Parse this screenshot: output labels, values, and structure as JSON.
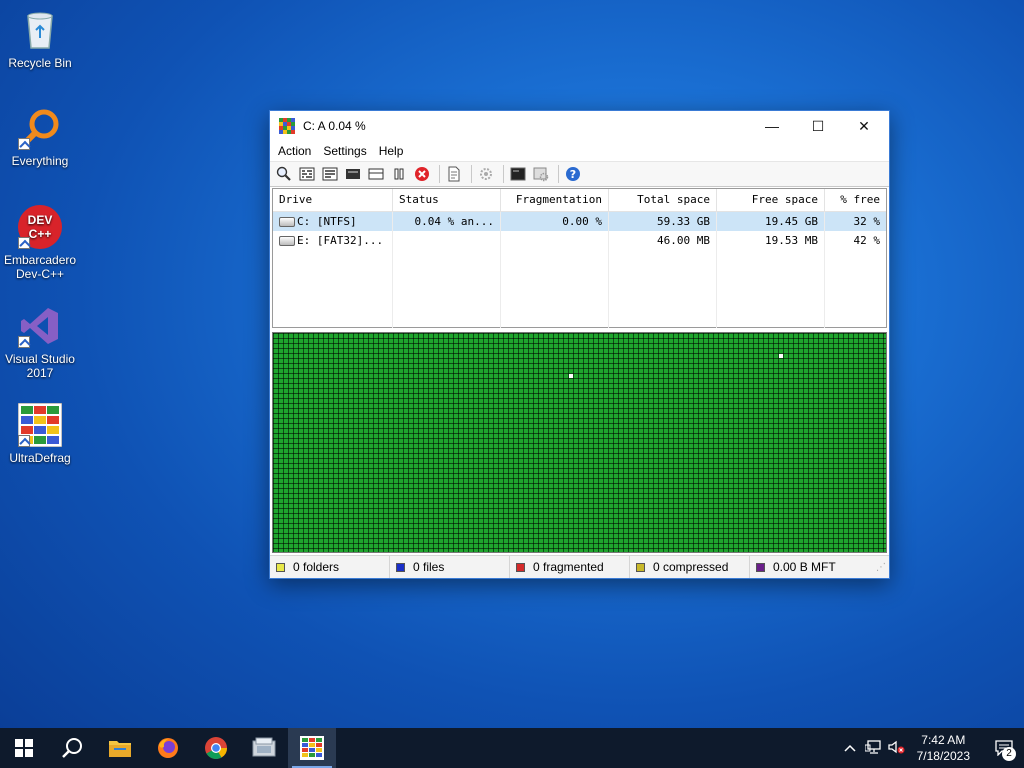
{
  "desktop": {
    "icons": [
      {
        "label": "Recycle Bin"
      },
      {
        "label": "Everything"
      },
      {
        "label": "Embarcadero Dev-C++",
        "logo_line1": "DEV",
        "logo_line2": "C++"
      },
      {
        "label": "Visual Studio 2017"
      },
      {
        "label": "UltraDefrag"
      }
    ]
  },
  "window": {
    "title": "C:  A   0.04 %",
    "controls": {
      "minimize": "—",
      "maximize": "☐",
      "close": "✕"
    },
    "menu": [
      "Action",
      "Settings",
      "Help"
    ],
    "toolbar_icons": [
      "analyze-icon",
      "defragment-icon",
      "quick-optimize-icon",
      "full-optimize-icon",
      "mft-optimize-icon",
      "pause-icon",
      "stop-icon",
      "report-icon",
      "preferences-icon",
      "boot-time-script-icon",
      "boot-time-enable-icon",
      "help-icon"
    ],
    "columns": [
      "Drive",
      "Status",
      "Fragmentation",
      "Total space",
      "Free space",
      "% free"
    ],
    "drives": [
      {
        "drive": "C: [NTFS]",
        "status": "0.04 % an...",
        "fragmentation": "0.00 %",
        "total": "59.33 GB",
        "free": "19.45 GB",
        "pct_free": "32 %"
      },
      {
        "drive": "E: [FAT32]...",
        "status": "",
        "fragmentation": "",
        "total": "46.00 MB",
        "free": "19.53 MB",
        "pct_free": "42 %"
      }
    ],
    "status_bar": [
      {
        "text": "0 folders",
        "color": "#e8e84a"
      },
      {
        "text": "0 files",
        "color": "#1a2fc8"
      },
      {
        "text": "0 fragmented",
        "color": "#d42a2a"
      },
      {
        "text": "0 compressed",
        "color": "#c8b82a"
      },
      {
        "text": "0.00 B MFT",
        "color": "#6a1f8a"
      }
    ],
    "map_color": "#1fa52e"
  },
  "taskbar": {
    "apps": [
      "start-icon",
      "search-icon",
      "file-explorer-icon",
      "firefox-icon",
      "chrome-icon",
      "app-icon",
      "ultradefrag-taskbar-icon"
    ],
    "tray": {
      "time": "7:42 AM",
      "date": "7/18/2023",
      "notifications": "2"
    }
  }
}
